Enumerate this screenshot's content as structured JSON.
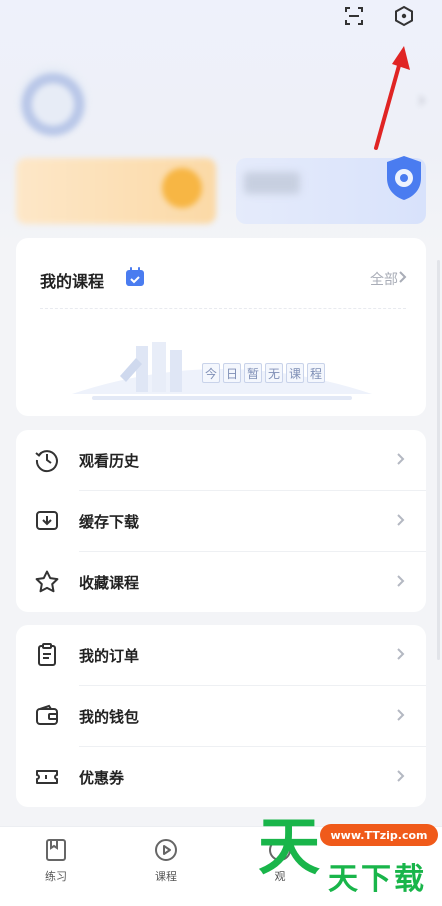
{
  "header": {
    "scan_icon": "scan-icon",
    "settings_icon": "settings-hexagon-icon",
    "profile_arrow": "›"
  },
  "courses": {
    "title": "我的课程",
    "all_label": "全部",
    "empty_chars": [
      "今",
      "日",
      "暂",
      "无",
      "课",
      "程"
    ]
  },
  "menu_group_1": [
    {
      "label": "观看历史",
      "icon": "history-clock-icon"
    },
    {
      "label": "缓存下载",
      "icon": "download-icon"
    },
    {
      "label": "收藏课程",
      "icon": "star-icon"
    }
  ],
  "menu_group_2": [
    {
      "label": "我的订单",
      "icon": "order-clipboard-icon"
    },
    {
      "label": "我的钱包",
      "icon": "wallet-icon"
    },
    {
      "label": "优惠券",
      "icon": "coupon-icon"
    }
  ],
  "tabbar": {
    "tabs": [
      {
        "label": "练习",
        "icon": "practice-book-icon"
      },
      {
        "label": "课程",
        "icon": "course-play-icon"
      },
      {
        "label": "观",
        "icon": "watch-icon"
      }
    ]
  },
  "watermark": {
    "url": "www.TTzip.com",
    "big_char": "天",
    "text": "天下载"
  },
  "colors": {
    "accent_blue": "#4a7cf0",
    "watermark_green": "#19b54a",
    "watermark_orange": "#f05a1a",
    "annotation_red": "#e02424"
  }
}
